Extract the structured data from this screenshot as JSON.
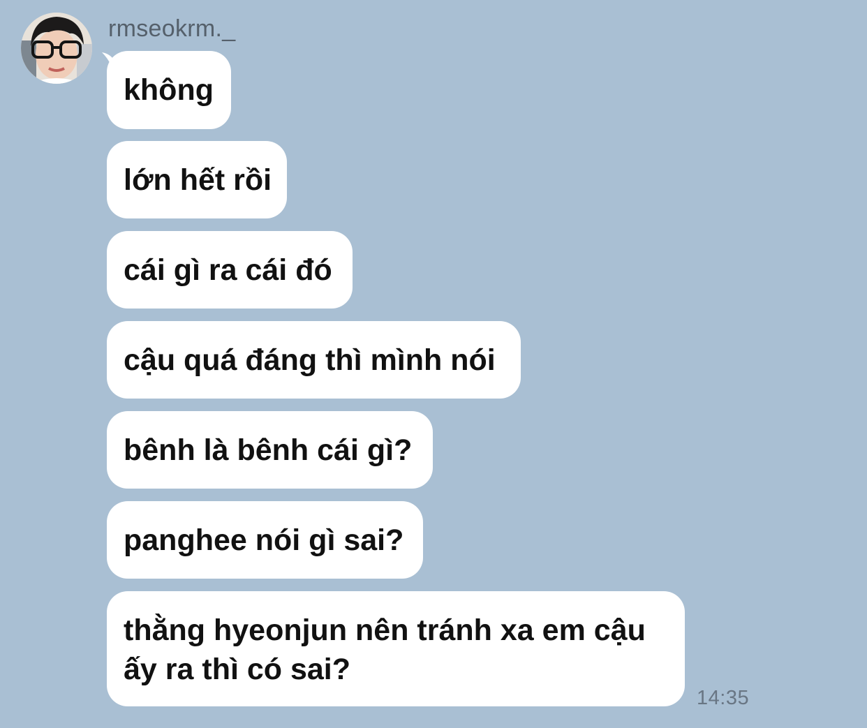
{
  "colors": {
    "background": "#a9bfd3",
    "bubble": "#ffffff",
    "text": "#111111",
    "sender": "#55606b",
    "timestamp": "#697684"
  },
  "chat": {
    "sender_name": "rmseokrm._",
    "avatar_icon": "profile-photo",
    "messages": [
      {
        "text": "không"
      },
      {
        "text": "lớn hết rồi"
      },
      {
        "text": "cái gì ra cái đó"
      },
      {
        "text": "cậu quá đáng thì mình nói"
      },
      {
        "text": "bênh là bênh cái gì?"
      },
      {
        "text": "panghee nói gì sai?"
      },
      {
        "text": "thằng hyeonjun nên tránh xa em cậu ấy ra thì có sai?"
      }
    ],
    "timestamp": "14:35"
  }
}
